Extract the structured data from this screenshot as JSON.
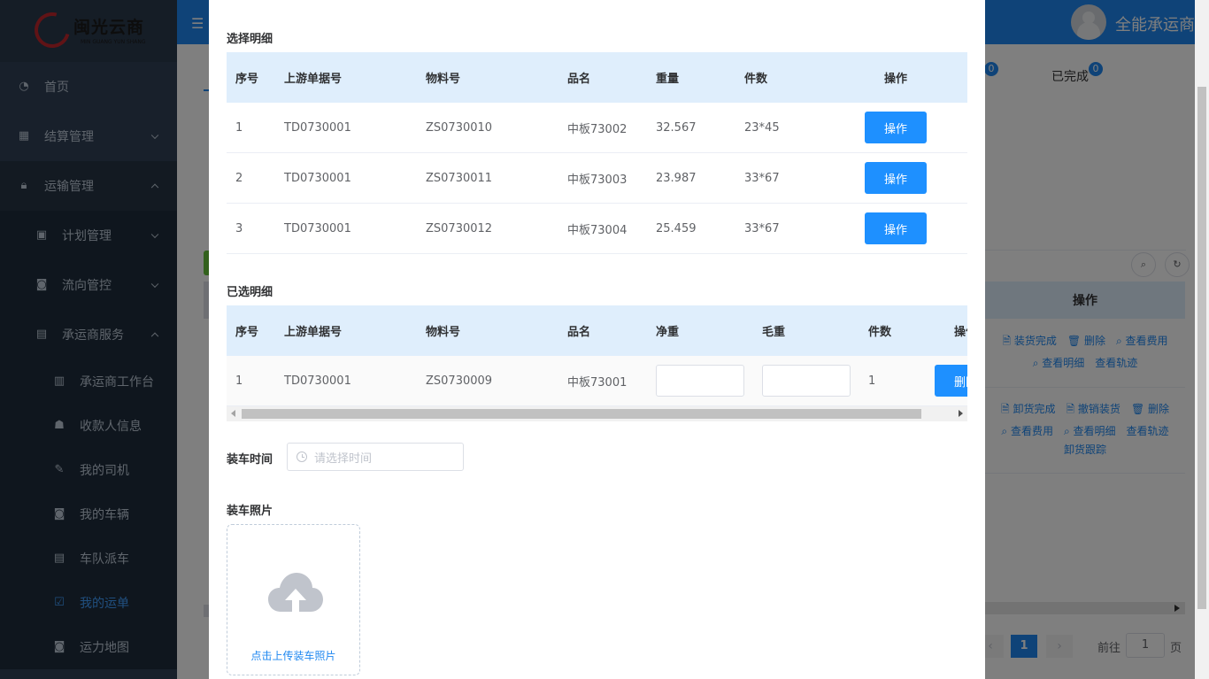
{
  "sidebar": {
    "logo": {
      "cn": "闽光云商",
      "en": "MIN GUANG YUN SHANG"
    },
    "items": [
      {
        "label": "首页",
        "icon": "dashboard-icon"
      },
      {
        "label": "结算管理",
        "icon": "grid-icon"
      },
      {
        "label": "运输管理",
        "icon": "lock-icon"
      },
      {
        "label": "计划管理",
        "icon": "briefcase-icon"
      },
      {
        "label": "流向管控",
        "icon": "target-icon"
      },
      {
        "label": "承运商服务",
        "icon": "card-icon"
      },
      {
        "label": "承运商工作台",
        "icon": "calendar-icon"
      },
      {
        "label": "收款人信息",
        "icon": "user-icon"
      },
      {
        "label": "我的司机",
        "icon": "doc-edit-icon"
      },
      {
        "label": "我的车辆",
        "icon": "target-icon"
      },
      {
        "label": "车队派车",
        "icon": "card-icon"
      },
      {
        "label": "我的运单",
        "icon": "checkbox-icon"
      },
      {
        "label": "运力地图",
        "icon": "target-icon"
      }
    ]
  },
  "topbar": {
    "username": "全能承运商"
  },
  "background": {
    "tabs": [
      {
        "label": "",
        "count": "0"
      },
      {
        "label": "已完成",
        "count": "0"
      }
    ],
    "table_header_op": "操作",
    "row1_links": [
      "装货完成",
      "删除",
      "查看费用",
      "查看明细",
      "查看轨迹"
    ],
    "row2_links": [
      "卸货完成",
      "撤销装货",
      "删除",
      "查看费用",
      "查看明细",
      "查看轨迹",
      "卸货跟踪"
    ],
    "pager": {
      "current": "1",
      "goto_label": "前往",
      "goto_value": "1",
      "page_suffix": "页"
    }
  },
  "dialog": {
    "select_title": "选择明细",
    "select_columns": [
      "序号",
      "上游单据号",
      "物料号",
      "品名",
      "重量",
      "件数",
      "操作"
    ],
    "select_rows": [
      [
        "1",
        "TD0730001",
        "ZS0730010",
        "中板73002",
        "32.567",
        "23*45"
      ],
      [
        "2",
        "TD0730001",
        "ZS0730011",
        "中板73003",
        "23.987",
        "33*67"
      ],
      [
        "3",
        "TD0730001",
        "ZS0730012",
        "中板73004",
        "25.459",
        "33*67"
      ]
    ],
    "op_button_label": "操作",
    "selected_title": "已选明细",
    "selected_columns": [
      "序号",
      "上游单据号",
      "物料号",
      "品名",
      "净重",
      "毛重",
      "件数",
      "操作"
    ],
    "selected_rows": [
      {
        "cells": [
          "1",
          "TD0730001",
          "ZS0730009",
          "中板73001"
        ],
        "net_weight": "",
        "gross_weight": "",
        "count": "1"
      }
    ],
    "delete_button_label": "删除",
    "load_time_label": "装车时间",
    "load_time_placeholder": "请选择时间",
    "load_photo_label": "装车照片",
    "upload_text": "点击上传装车照片"
  }
}
